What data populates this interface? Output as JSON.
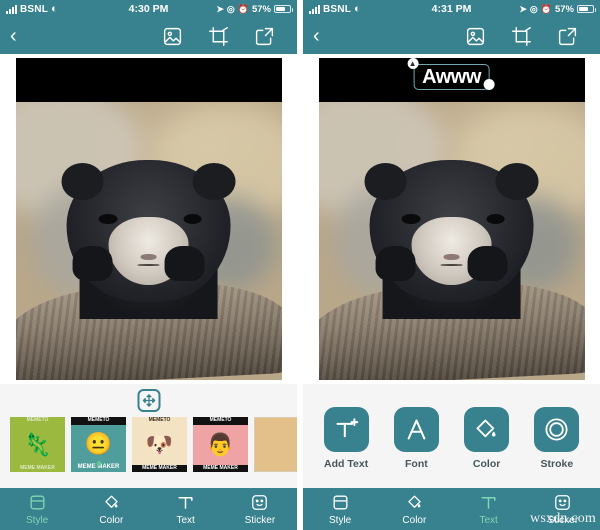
{
  "screens": [
    {
      "id": "style-screen",
      "status_bar": {
        "carrier": "BSNL",
        "wifi_icon": "wifi-icon",
        "time": "4:30 PM",
        "location_icon": "location-arrow-icon",
        "orientation_lock_icon": "rotation-lock-icon",
        "alarm_icon": "alarm-clock-icon",
        "battery_percent": "57%",
        "battery_icon": "battery-icon"
      },
      "toolbar": {
        "back_icon": "chevron-left-icon",
        "actions": [
          {
            "icon": "photo-picker-icon",
            "name": "choose-image-button"
          },
          {
            "icon": "crop-icon",
            "name": "crop-button"
          },
          {
            "icon": "share-export-icon",
            "name": "share-button"
          }
        ]
      },
      "canvas": {
        "top_band_text": "",
        "image_alt": "confession bear photo"
      },
      "style_panel": {
        "move_icon": "move-arrows-icon",
        "templates": [
          {
            "top": "MEMETO",
            "bottom": "MEME MAKER",
            "art": "frog",
            "selected": false
          },
          {
            "top": "MEMETO",
            "bottom": "MEME MAKER",
            "art": "face",
            "selected": true
          },
          {
            "top": "MEMETO",
            "bottom": "MEME MAKER",
            "art": "doge",
            "selected": false
          },
          {
            "top": "MEMETO",
            "bottom": "MEME MAKER",
            "art": "suit",
            "selected": false
          },
          {
            "top": "",
            "bottom": "",
            "art": "plain",
            "selected": false
          }
        ]
      },
      "bottom_nav": {
        "active": "Style",
        "items": [
          {
            "label": "Style",
            "icon": "style-panel-icon"
          },
          {
            "label": "Color",
            "icon": "paint-bucket-icon"
          },
          {
            "label": "Text",
            "icon": "text-tool-icon"
          },
          {
            "label": "Sticker",
            "icon": "smiley-sticker-icon"
          }
        ]
      },
      "watermark": ""
    },
    {
      "id": "text-screen",
      "status_bar": {
        "carrier": "BSNL",
        "wifi_icon": "wifi-icon",
        "time": "4:31 PM",
        "location_icon": "location-arrow-icon",
        "orientation_lock_icon": "rotation-lock-icon",
        "alarm_icon": "alarm-clock-icon",
        "battery_percent": "57%",
        "battery_icon": "battery-icon"
      },
      "toolbar": {
        "back_icon": "chevron-left-icon",
        "actions": [
          {
            "icon": "photo-picker-icon",
            "name": "choose-image-button"
          },
          {
            "icon": "crop-icon",
            "name": "crop-button"
          },
          {
            "icon": "share-export-icon",
            "name": "share-button"
          }
        ]
      },
      "canvas": {
        "top_band_text": "Awww",
        "text_selected": true,
        "rotate_handle_icon": "rotate-handle-icon",
        "resize_handle_icon": "resize-handle-icon",
        "image_alt": "confession bear photo"
      },
      "text_tools": [
        {
          "label": "Add Text",
          "icon": "add-text-icon"
        },
        {
          "label": "Font",
          "icon": "font-icon"
        },
        {
          "label": "Color",
          "icon": "paint-bucket-icon"
        },
        {
          "label": "Stroke",
          "icon": "stroke-rings-icon"
        }
      ],
      "bottom_nav": {
        "active": "Text",
        "items": [
          {
            "label": "Style",
            "icon": "style-panel-icon"
          },
          {
            "label": "Color",
            "icon": "paint-bucket-icon"
          },
          {
            "label": "Text",
            "icon": "text-tool-icon"
          },
          {
            "label": "Sticker",
            "icon": "smiley-sticker-icon"
          }
        ]
      },
      "watermark": "wsxdn.com"
    }
  ],
  "theme": {
    "accent": "#38818e",
    "panel_bg": "#f5f5f5",
    "active_nav": "#7fd6b4",
    "selection_border": "#6fa8ae"
  }
}
